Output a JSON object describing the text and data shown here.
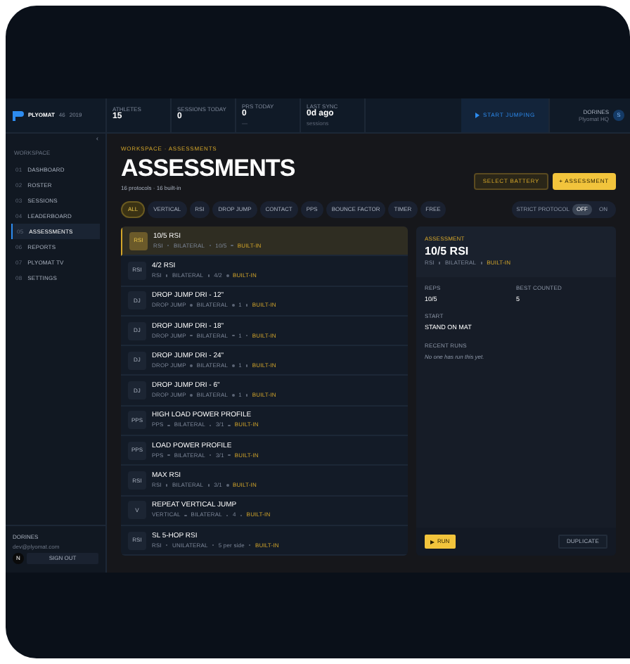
{
  "header": {
    "brand": "PLYOMAT",
    "meta": [
      "46",
      "2019"
    ],
    "stats": [
      {
        "label": "ATHLETES",
        "value": "15"
      },
      {
        "label": "SESSIONS TODAY",
        "value": "0"
      },
      {
        "label": "PRS TODAY",
        "value": "0",
        "sub": "—"
      },
      {
        "label": "LAST SYNC",
        "value": "0d ago",
        "sub": "sessions"
      }
    ],
    "action": "START JUMPING",
    "user": {
      "name": "DORINES",
      "sub": "Plyomat HQ",
      "initial": "S"
    }
  },
  "sidebar": {
    "collapse": "‹",
    "section": "WORKSPACE",
    "items": [
      {
        "num": "01",
        "label": "DASHBOARD",
        "selected": false
      },
      {
        "num": "02",
        "label": "ROSTER",
        "selected": false
      },
      {
        "num": "03",
        "label": "SESSIONS",
        "selected": false
      },
      {
        "num": "04",
        "label": "LEADERBOARD",
        "selected": false
      },
      {
        "num": "05",
        "label": "ASSESSMENTS",
        "selected": true
      },
      {
        "num": "06",
        "label": "REPORTS",
        "selected": false
      },
      {
        "num": "07",
        "label": "PLYOMAT TV",
        "selected": false
      },
      {
        "num": "08",
        "label": "SETTINGS",
        "selected": false
      }
    ],
    "account": {
      "name": "DORINES",
      "email": "dev@plyomat.com",
      "initial": "N",
      "signout": "SIGN OUT"
    }
  },
  "page": {
    "breadcrumb": "WORKSPACE · ASSESSMENTS",
    "title": "ASSESSMENTS",
    "subtitle": "16 protocols · 16 built-in",
    "buttons": [
      "SELECT BATTERY",
      "+ ASSESSMENT"
    ],
    "filters": [
      {
        "label": "ALL",
        "selected": true
      },
      {
        "label": "VERTICAL",
        "selected": false
      },
      {
        "label": "RSI",
        "selected": false
      },
      {
        "label": "DROP JUMP",
        "selected": false
      },
      {
        "label": "CONTACT",
        "selected": false
      },
      {
        "label": "PPS",
        "selected": false
      },
      {
        "label": "BOUNCE FACTOR",
        "selected": false
      },
      {
        "label": "TIMER",
        "selected": false
      },
      {
        "label": "FREE",
        "selected": false
      }
    ],
    "strict": {
      "label": "STRICT PROTOCOL",
      "options": [
        {
          "label": "OFF",
          "selected": true
        },
        {
          "label": "ON",
          "selected": false
        }
      ]
    }
  },
  "protocols": [
    {
      "badge": "RSI",
      "name": "10/5 RSI",
      "meta": [
        "RSI",
        "BILATERAL",
        "10/5"
      ],
      "tag": "BUILT-IN",
      "selected": true
    },
    {
      "badge": "RSI",
      "name": "4/2 RSI",
      "meta": [
        "RSI",
        "BILATERAL",
        "4/2"
      ],
      "tag": "BUILT-IN",
      "selected": false
    },
    {
      "badge": "DJ",
      "name": "DROP JUMP DRI - 12\"",
      "meta": [
        "DROP JUMP",
        "BILATERAL",
        "1"
      ],
      "tag": "BUILT-IN",
      "selected": false
    },
    {
      "badge": "DJ",
      "name": "DROP JUMP DRI - 18\"",
      "meta": [
        "DROP JUMP",
        "BILATERAL",
        "1"
      ],
      "tag": "BUILT-IN",
      "selected": false
    },
    {
      "badge": "DJ",
      "name": "DROP JUMP DRI - 24\"",
      "meta": [
        "DROP JUMP",
        "BILATERAL",
        "1"
      ],
      "tag": "BUILT-IN",
      "selected": false
    },
    {
      "badge": "DJ",
      "name": "DROP JUMP DRI - 6\"",
      "meta": [
        "DROP JUMP",
        "BILATERAL",
        "1"
      ],
      "tag": "BUILT-IN",
      "selected": false
    },
    {
      "badge": "PPS",
      "name": "HIGH LOAD POWER PROFILE",
      "meta": [
        "PPS",
        "BILATERAL",
        "3/1"
      ],
      "tag": "BUILT-IN",
      "selected": false
    },
    {
      "badge": "PPS",
      "name": "LOAD POWER PROFILE",
      "meta": [
        "PPS",
        "BILATERAL",
        "3/1"
      ],
      "tag": "BUILT-IN",
      "selected": false
    },
    {
      "badge": "RSI",
      "name": "MAX RSI",
      "meta": [
        "RSI",
        "BILATERAL",
        "3/1"
      ],
      "tag": "BUILT-IN",
      "selected": false
    },
    {
      "badge": "V",
      "name": "REPEAT VERTICAL JUMP",
      "meta": [
        "VERTICAL",
        "BILATERAL",
        "4"
      ],
      "tag": "BUILT-IN",
      "selected": false
    },
    {
      "badge": "RSI",
      "name": "SL 5-HOP RSI",
      "meta": [
        "RSI",
        "UNILATERAL",
        "5 per side"
      ],
      "tag": "BUILT-IN",
      "selected": false
    }
  ],
  "detail": {
    "eyebrow": "ASSESSMENT",
    "title": "10/5 RSI",
    "meta": [
      "RSI",
      "BILATERAL"
    ],
    "tag": "BUILT-IN",
    "fields": [
      {
        "label": "REPS",
        "value": "10/5"
      },
      {
        "label": "BEST COUNTED",
        "value": "5"
      },
      {
        "label": "START",
        "value": "STAND ON MAT"
      }
    ],
    "recent_label": "RECENT RUNS",
    "recent_empty": "No one has run this yet.",
    "run": "RUN",
    "duplicate": "DUPLICATE"
  }
}
